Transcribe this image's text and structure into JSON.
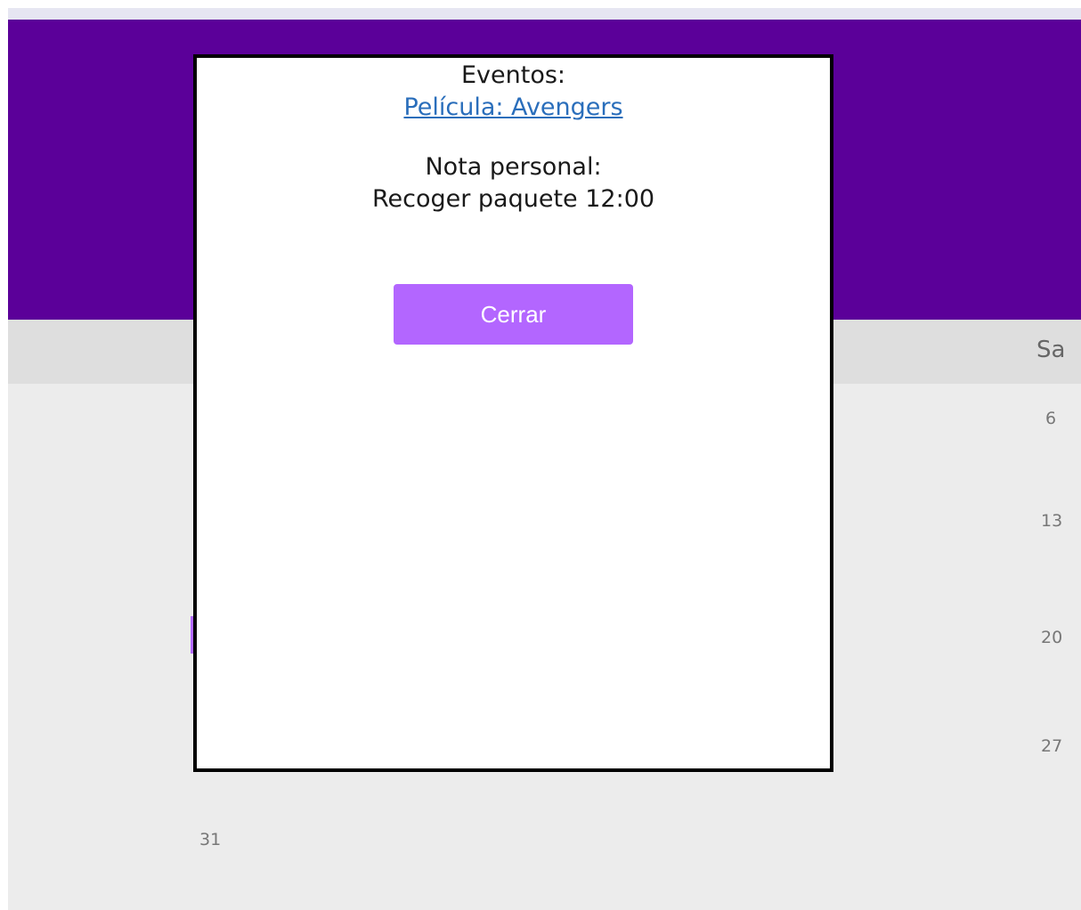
{
  "calendar": {
    "weekday_visible": "Sa",
    "days": [
      "6",
      "13",
      "20",
      "27",
      "31"
    ]
  },
  "modal": {
    "events_heading": "Eventos:",
    "event_link": "Película: Avengers",
    "note_heading": "Nota personal:",
    "note_text": "Recoger paquete 12:00",
    "close_label": "Cerrar"
  },
  "colors": {
    "header": "#5b0099",
    "button": "#b366ff",
    "link": "#2a6ebb"
  }
}
